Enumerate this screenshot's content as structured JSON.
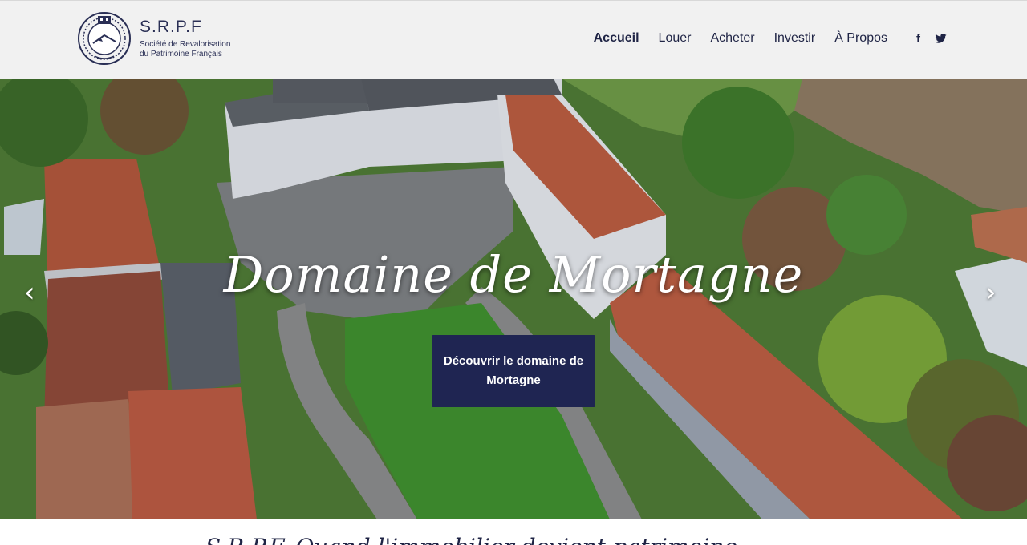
{
  "header": {
    "logo": {
      "title": "S.R.P.F",
      "subtitle_line1": "Société de Revalorisation",
      "subtitle_line2": "du Patrimoine Français",
      "icon": "srpf-emblem-icon"
    },
    "nav": [
      {
        "label": "Accueil",
        "active": true
      },
      {
        "label": "Louer",
        "active": false
      },
      {
        "label": "Acheter",
        "active": false
      },
      {
        "label": "Investir",
        "active": false
      },
      {
        "label": "À Propos",
        "active": false
      }
    ],
    "social": [
      {
        "icon": "facebook-icon",
        "glyph": "f"
      },
      {
        "icon": "twitter-icon"
      }
    ]
  },
  "hero": {
    "title": "Domaine de Mortagne",
    "cta_label": "Découvrir le domaine de Mortagne",
    "prev_icon": "chevron-left-icon",
    "next_icon": "chevron-right-icon",
    "prev_glyph": "‹",
    "next_glyph": "›"
  },
  "section": {
    "heading_partial": "S.R.P.F. Quand l'immobilier devient patrimoine"
  },
  "colors": {
    "header_bg": "#f1f1f1",
    "brand_navy": "#1f2552",
    "nav_text": "#1f2445"
  }
}
